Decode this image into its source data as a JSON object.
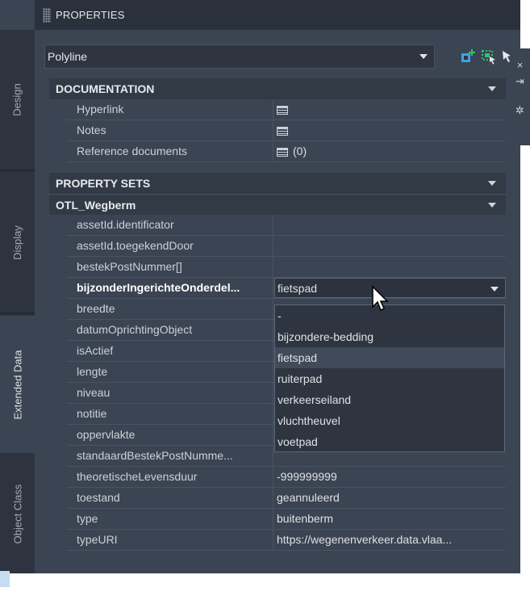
{
  "title": "PROPERTIES",
  "side_tabs": [
    "Design",
    "Display",
    "Extended Data",
    "Object Class"
  ],
  "right_tools": [
    "×",
    "⇥",
    "✲"
  ],
  "selector": {
    "value": "Polyline"
  },
  "categories": {
    "documentation": "DOCUMENTATION",
    "property_sets": "PROPERTY SETS",
    "otl": "OTL_Wegberm"
  },
  "documentation_rows": [
    {
      "name": "Hyperlink",
      "value": ""
    },
    {
      "name": "Notes",
      "value": ""
    },
    {
      "name": "Reference documents",
      "value": "(0)"
    }
  ],
  "otl_rows": [
    {
      "name": "assetId.identificator",
      "value": ""
    },
    {
      "name": "assetId.toegekendDoor",
      "value": ""
    },
    {
      "name": "bestekPostNummer[]",
      "value": ""
    },
    {
      "name": "bijzonderIngerichteOnderdel...",
      "value": "fietspad"
    },
    {
      "name": "breedte",
      "value": ""
    },
    {
      "name": "datumOprichtingObject",
      "value": ""
    },
    {
      "name": "isActief",
      "value": ""
    },
    {
      "name": "lengte",
      "value": ""
    },
    {
      "name": "niveau",
      "value": ""
    },
    {
      "name": "notitie",
      "value": ""
    },
    {
      "name": "oppervlakte",
      "value": ""
    },
    {
      "name": "standaardBestekPostNumme...",
      "value": ""
    },
    {
      "name": "theoretischeLevensduur",
      "value": "-999999999"
    },
    {
      "name": "toestand",
      "value": "geannuleerd"
    },
    {
      "name": "type",
      "value": "buitenberm"
    },
    {
      "name": "typeURI",
      "value": "https://wegenenverkeer.data.vlaa..."
    }
  ],
  "dropdown_options": [
    "-",
    "bijzondere-bedding",
    "fietspad",
    "ruiterpad",
    "verkeerseiland",
    "vluchtheuvel",
    "voetpad"
  ],
  "dropdown_selected": "fietspad",
  "colors": {
    "panel_bg": "#3b4453",
    "title_bg": "#2a313c",
    "category_bg": "#323a46",
    "add_icon": "#3fa3e0",
    "select_icon": "#35c06a",
    "pick_icon": "#e3b54a"
  }
}
